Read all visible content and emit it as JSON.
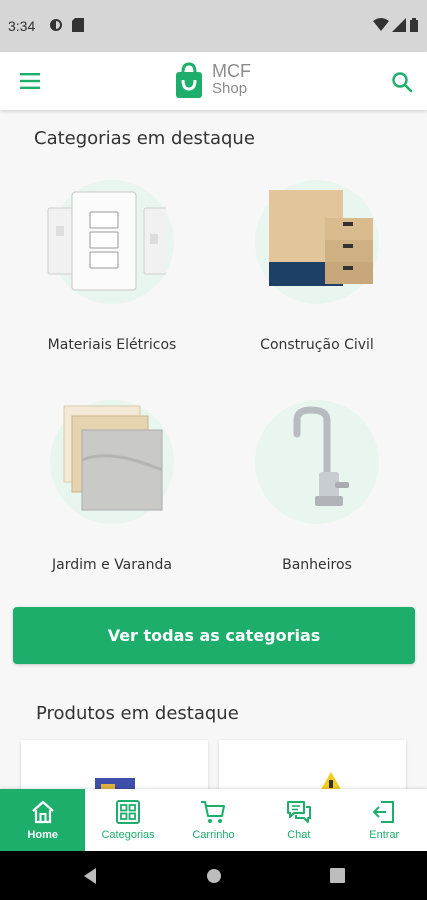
{
  "status_bar": {
    "time": "3:34"
  },
  "header": {
    "logo_line1": "MCF",
    "logo_line2": "Shop"
  },
  "featured_categories": {
    "title": "Categorias em destaque",
    "items": [
      {
        "label": "Materiais Elétricos",
        "icon": "electrical-outlets-image"
      },
      {
        "label": "Construção Civil",
        "icon": "cement-bags-image"
      },
      {
        "label": "Jardim e Varanda",
        "icon": "floor-tiles-image"
      },
      {
        "label": "Banheiros",
        "icon": "faucet-image"
      }
    ]
  },
  "view_all_button": "Ver todas as categorias",
  "featured_products": {
    "title": "Produtos em destaque"
  },
  "bottom_nav": [
    {
      "label": "Home",
      "icon": "home-icon",
      "active": true
    },
    {
      "label": "Categorias",
      "icon": "grid-icon",
      "active": false
    },
    {
      "label": "Carrinho",
      "icon": "cart-icon",
      "active": false
    },
    {
      "label": "Chat",
      "icon": "chat-icon",
      "active": false
    },
    {
      "label": "Entrar",
      "icon": "login-icon",
      "active": false
    }
  ],
  "colors": {
    "accent": "#1dae6b",
    "circle_bg": "#e9f6ef",
    "status_bar": "#d6d6d6"
  }
}
